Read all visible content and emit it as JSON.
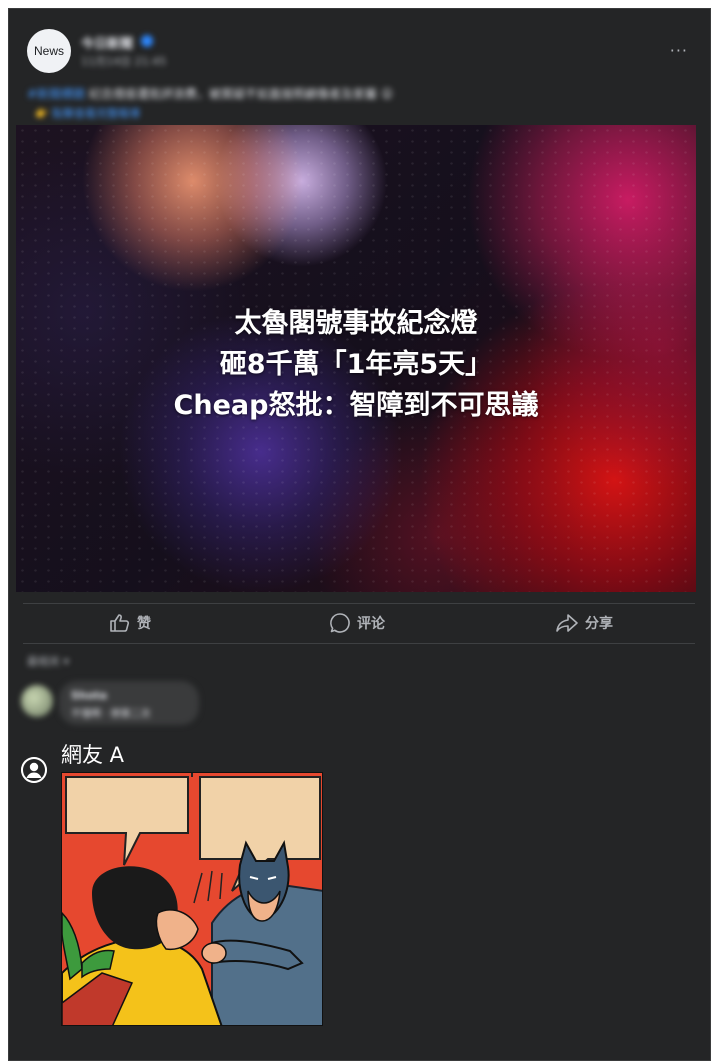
{
  "post": {
    "avatar_text": "News",
    "author_name": "今日新聞",
    "timestamp": "11月14日 21:45",
    "caption_link": "#新聞標題",
    "caption_text": "纪念燈座遭批評浪費，被質疑不如直接照顧傷者及家屬 😮",
    "caption_more": "👉 點擊查看完整報導"
  },
  "image": {
    "headline_lines": [
      "太魯閣號事故紀念燈",
      "砸8千萬「1年亮5天」",
      "Cheap怒批：智障到不可思議"
    ]
  },
  "actions": {
    "like_label": "赞",
    "comment_label": "评论",
    "share_label": "分享"
  },
  "comments": {
    "sort_label": "最相关 ▾",
    "first_commenter": "Shota",
    "first_comment_text": "不懂啊 · 想第二次"
  },
  "reply": {
    "user_name": "網友 A"
  },
  "colors": {
    "post_bg": "#242526",
    "text_primary": "#e4e6eb",
    "text_secondary": "#b0b3b8",
    "link": "#4599ff"
  }
}
